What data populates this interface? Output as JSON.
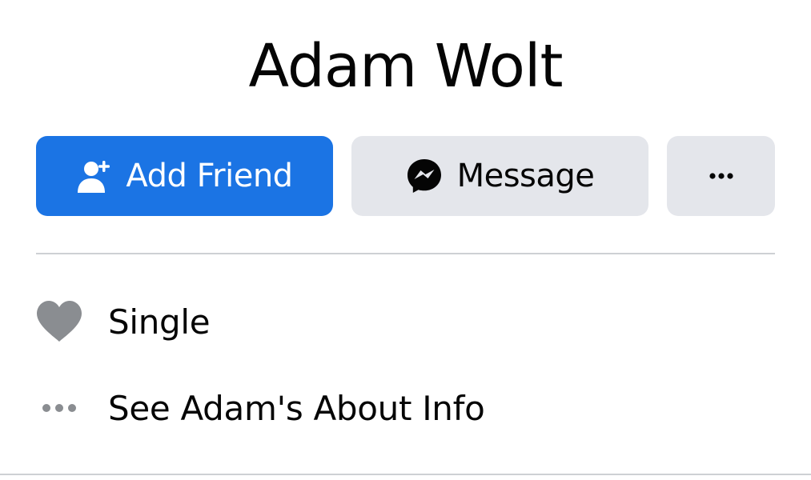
{
  "profile": {
    "name": "Adam Wolt"
  },
  "actions": {
    "add_friend_label": "Add Friend",
    "add_friend_icon": "add-person-icon",
    "message_label": "Message",
    "message_icon": "messenger-icon",
    "more_icon": "more-horizontal-icon"
  },
  "info": {
    "items": [
      {
        "icon": "heart-icon",
        "label": "Single"
      },
      {
        "icon": "more-dots-icon",
        "label": "See Adam's About Info"
      }
    ]
  },
  "colors": {
    "primary_button": "#1b74e4",
    "secondary_button": "#e4e6eb",
    "icon_gray": "#8a8d91",
    "divider": "#ced0d4"
  }
}
